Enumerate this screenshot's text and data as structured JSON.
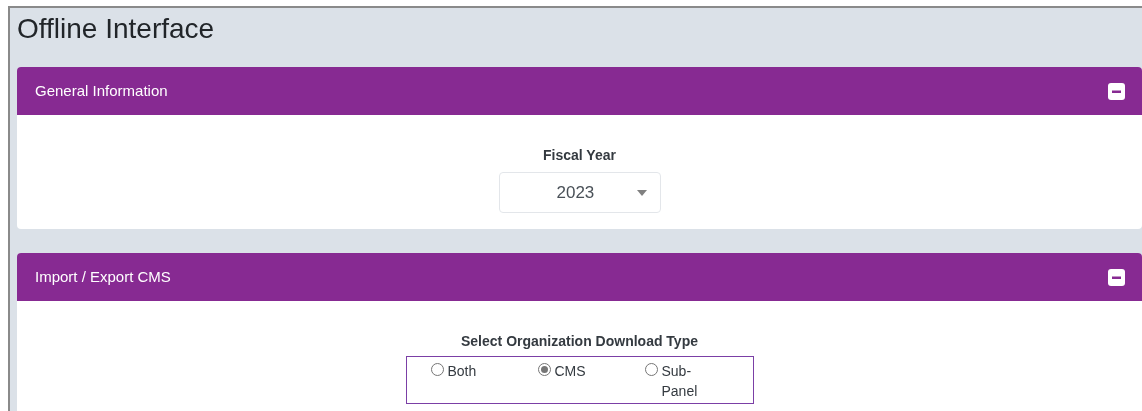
{
  "page_title": "Offline Interface",
  "panels": [
    {
      "title": "General Information",
      "expanded": true,
      "kind": "select",
      "label": "Fiscal Year",
      "select": {
        "value": "2023"
      }
    },
    {
      "title": "Import / Export CMS",
      "expanded": true,
      "kind": "radios",
      "label": "Select Organization Download Type",
      "options": [
        {
          "label": "Both",
          "selected": false
        },
        {
          "label": "CMS",
          "selected": true
        },
        {
          "label": "Sub-Panel",
          "selected": false
        }
      ]
    }
  ]
}
